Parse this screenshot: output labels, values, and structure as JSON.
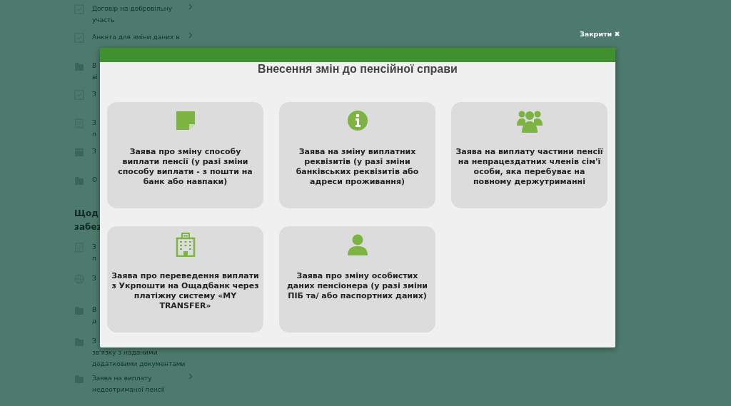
{
  "sidebar": {
    "groups": [
      {
        "items": [
          {
            "kind": "check",
            "lines": [
              "Договір на добровільну",
              "участь"
            ],
            "chevron": true
          },
          {
            "kind": "check",
            "lines": [
              "Анкета для зміни даних в"
            ],
            "chevron": true
          },
          {
            "kind": "folder",
            "lines": [
              "В",
              "ві"
            ],
            "chevron": false
          },
          {
            "kind": "check",
            "lines": [
              "З"
            ],
            "chevron": false
          },
          {
            "kind": "doc",
            "lines": [
              "З",
              "п"
            ],
            "chevron": false
          },
          {
            "kind": "calendar",
            "lines": [
              "З"
            ],
            "chevron": false
          },
          {
            "kind": "folder",
            "lines": [
              "О"
            ],
            "chevron": false
          }
        ]
      },
      {
        "heading": [
          "Щод",
          "забез"
        ],
        "items": [
          {
            "kind": "doc",
            "lines": [
              "З",
              "п"
            ],
            "chevron": false
          },
          {
            "kind": "globe",
            "lines": [
              "З"
            ],
            "chevron": false
          },
          {
            "kind": "folder",
            "lines": [
              "В",
              "д"
            ],
            "chevron": false
          },
          {
            "kind": "folder",
            "lines": [
              "З",
              "зв'язку з наданими",
              "додатковими документами"
            ],
            "chevron": false
          },
          {
            "kind": "folder",
            "lines": [
              "Заява на виплату",
              "недоотриманої пенсії"
            ],
            "chevron": true
          }
        ]
      }
    ]
  },
  "close": {
    "label": "Закрити ✖"
  },
  "modal": {
    "title": "Внесення змін до пенсійної справи",
    "cards": [
      {
        "kind": "note",
        "text": "Заява про зміну способу виплати пенсії (у разі зміни способу виплати - з пошти на банк або навпаки)"
      },
      {
        "kind": "info",
        "text": "Заява на зміну виплатних реквізитів (у разі зміни банківських реквізитів або адреси проживання)"
      },
      {
        "kind": "group",
        "text": "Заява на виплату частини пенсії на непрацездатних членів сім'ї особи, яка перебуває на повному держутриманні"
      },
      {
        "kind": "building",
        "text": "Заява про переведення виплати з Укрпошти на Ощадбанк через платіжну систему «MY TRANSFER»"
      },
      {
        "kind": "person",
        "text": "Заява про зміну особистих даних пенсіонера (у разі зміни ПІБ та/ або паспортних даних)"
      }
    ]
  }
}
